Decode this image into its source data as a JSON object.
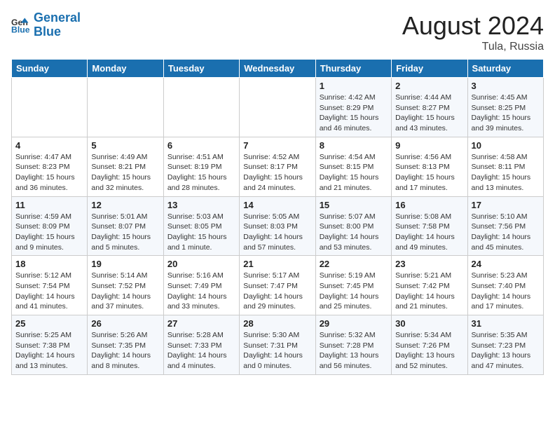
{
  "header": {
    "logo_text_1": "General",
    "logo_text_2": "Blue",
    "month_year": "August 2024",
    "location": "Tula, Russia"
  },
  "days_of_week": [
    "Sunday",
    "Monday",
    "Tuesday",
    "Wednesday",
    "Thursday",
    "Friday",
    "Saturday"
  ],
  "weeks": [
    [
      {
        "day": "",
        "sunrise": "",
        "sunset": "",
        "daylight": ""
      },
      {
        "day": "",
        "sunrise": "",
        "sunset": "",
        "daylight": ""
      },
      {
        "day": "",
        "sunrise": "",
        "sunset": "",
        "daylight": ""
      },
      {
        "day": "",
        "sunrise": "",
        "sunset": "",
        "daylight": ""
      },
      {
        "day": "1",
        "sunrise": "Sunrise: 4:42 AM",
        "sunset": "Sunset: 8:29 PM",
        "daylight": "Daylight: 15 hours and 46 minutes."
      },
      {
        "day": "2",
        "sunrise": "Sunrise: 4:44 AM",
        "sunset": "Sunset: 8:27 PM",
        "daylight": "Daylight: 15 hours and 43 minutes."
      },
      {
        "day": "3",
        "sunrise": "Sunrise: 4:45 AM",
        "sunset": "Sunset: 8:25 PM",
        "daylight": "Daylight: 15 hours and 39 minutes."
      }
    ],
    [
      {
        "day": "4",
        "sunrise": "Sunrise: 4:47 AM",
        "sunset": "Sunset: 8:23 PM",
        "daylight": "Daylight: 15 hours and 36 minutes."
      },
      {
        "day": "5",
        "sunrise": "Sunrise: 4:49 AM",
        "sunset": "Sunset: 8:21 PM",
        "daylight": "Daylight: 15 hours and 32 minutes."
      },
      {
        "day": "6",
        "sunrise": "Sunrise: 4:51 AM",
        "sunset": "Sunset: 8:19 PM",
        "daylight": "Daylight: 15 hours and 28 minutes."
      },
      {
        "day": "7",
        "sunrise": "Sunrise: 4:52 AM",
        "sunset": "Sunset: 8:17 PM",
        "daylight": "Daylight: 15 hours and 24 minutes."
      },
      {
        "day": "8",
        "sunrise": "Sunrise: 4:54 AM",
        "sunset": "Sunset: 8:15 PM",
        "daylight": "Daylight: 15 hours and 21 minutes."
      },
      {
        "day": "9",
        "sunrise": "Sunrise: 4:56 AM",
        "sunset": "Sunset: 8:13 PM",
        "daylight": "Daylight: 15 hours and 17 minutes."
      },
      {
        "day": "10",
        "sunrise": "Sunrise: 4:58 AM",
        "sunset": "Sunset: 8:11 PM",
        "daylight": "Daylight: 15 hours and 13 minutes."
      }
    ],
    [
      {
        "day": "11",
        "sunrise": "Sunrise: 4:59 AM",
        "sunset": "Sunset: 8:09 PM",
        "daylight": "Daylight: 15 hours and 9 minutes."
      },
      {
        "day": "12",
        "sunrise": "Sunrise: 5:01 AM",
        "sunset": "Sunset: 8:07 PM",
        "daylight": "Daylight: 15 hours and 5 minutes."
      },
      {
        "day": "13",
        "sunrise": "Sunrise: 5:03 AM",
        "sunset": "Sunset: 8:05 PM",
        "daylight": "Daylight: 15 hours and 1 minute."
      },
      {
        "day": "14",
        "sunrise": "Sunrise: 5:05 AM",
        "sunset": "Sunset: 8:03 PM",
        "daylight": "Daylight: 14 hours and 57 minutes."
      },
      {
        "day": "15",
        "sunrise": "Sunrise: 5:07 AM",
        "sunset": "Sunset: 8:00 PM",
        "daylight": "Daylight: 14 hours and 53 minutes."
      },
      {
        "day": "16",
        "sunrise": "Sunrise: 5:08 AM",
        "sunset": "Sunset: 7:58 PM",
        "daylight": "Daylight: 14 hours and 49 minutes."
      },
      {
        "day": "17",
        "sunrise": "Sunrise: 5:10 AM",
        "sunset": "Sunset: 7:56 PM",
        "daylight": "Daylight: 14 hours and 45 minutes."
      }
    ],
    [
      {
        "day": "18",
        "sunrise": "Sunrise: 5:12 AM",
        "sunset": "Sunset: 7:54 PM",
        "daylight": "Daylight: 14 hours and 41 minutes."
      },
      {
        "day": "19",
        "sunrise": "Sunrise: 5:14 AM",
        "sunset": "Sunset: 7:52 PM",
        "daylight": "Daylight: 14 hours and 37 minutes."
      },
      {
        "day": "20",
        "sunrise": "Sunrise: 5:16 AM",
        "sunset": "Sunset: 7:49 PM",
        "daylight": "Daylight: 14 hours and 33 minutes."
      },
      {
        "day": "21",
        "sunrise": "Sunrise: 5:17 AM",
        "sunset": "Sunset: 7:47 PM",
        "daylight": "Daylight: 14 hours and 29 minutes."
      },
      {
        "day": "22",
        "sunrise": "Sunrise: 5:19 AM",
        "sunset": "Sunset: 7:45 PM",
        "daylight": "Daylight: 14 hours and 25 minutes."
      },
      {
        "day": "23",
        "sunrise": "Sunrise: 5:21 AM",
        "sunset": "Sunset: 7:42 PM",
        "daylight": "Daylight: 14 hours and 21 minutes."
      },
      {
        "day": "24",
        "sunrise": "Sunrise: 5:23 AM",
        "sunset": "Sunset: 7:40 PM",
        "daylight": "Daylight: 14 hours and 17 minutes."
      }
    ],
    [
      {
        "day": "25",
        "sunrise": "Sunrise: 5:25 AM",
        "sunset": "Sunset: 7:38 PM",
        "daylight": "Daylight: 14 hours and 13 minutes."
      },
      {
        "day": "26",
        "sunrise": "Sunrise: 5:26 AM",
        "sunset": "Sunset: 7:35 PM",
        "daylight": "Daylight: 14 hours and 8 minutes."
      },
      {
        "day": "27",
        "sunrise": "Sunrise: 5:28 AM",
        "sunset": "Sunset: 7:33 PM",
        "daylight": "Daylight: 14 hours and 4 minutes."
      },
      {
        "day": "28",
        "sunrise": "Sunrise: 5:30 AM",
        "sunset": "Sunset: 7:31 PM",
        "daylight": "Daylight: 14 hours and 0 minutes."
      },
      {
        "day": "29",
        "sunrise": "Sunrise: 5:32 AM",
        "sunset": "Sunset: 7:28 PM",
        "daylight": "Daylight: 13 hours and 56 minutes."
      },
      {
        "day": "30",
        "sunrise": "Sunrise: 5:34 AM",
        "sunset": "Sunset: 7:26 PM",
        "daylight": "Daylight: 13 hours and 52 minutes."
      },
      {
        "day": "31",
        "sunrise": "Sunrise: 5:35 AM",
        "sunset": "Sunset: 7:23 PM",
        "daylight": "Daylight: 13 hours and 47 minutes."
      }
    ]
  ]
}
